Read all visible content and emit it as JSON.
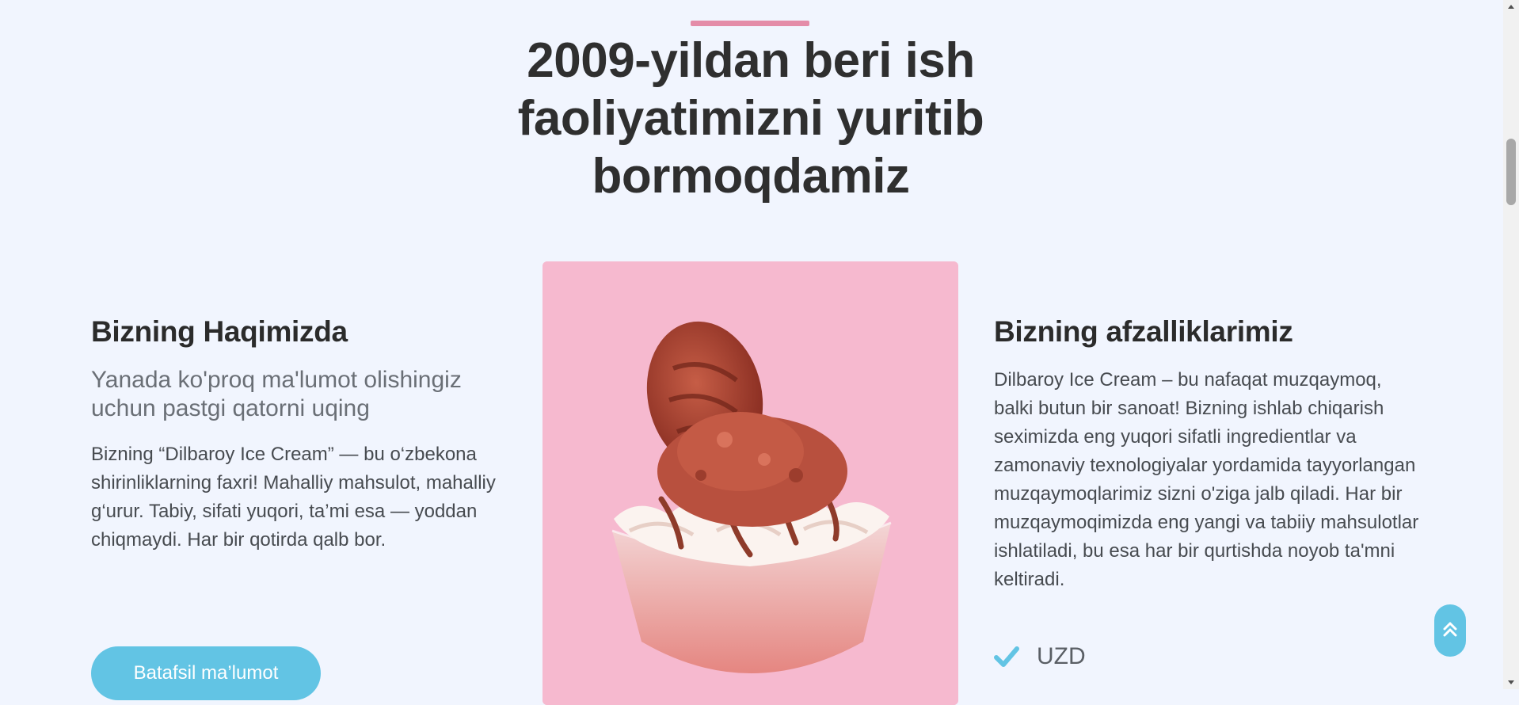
{
  "section": {
    "title": "2009-yildan beri ish faoliyatimizni yuritib bormoqdamiz"
  },
  "about": {
    "heading": "Bizning Haqimizda",
    "subheading": "Yanada ko'proq ma'lumot olishingiz uchun pastgi qatorni uqing",
    "text": "Bizning “Dilbaroy Ice Cream” — bu o‘zbekona shirinliklarning faxri! Mahalliy mahsulot, mahalliy g‘urur. Tabiy, sifati yuqori, ta’mi esa — yoddan chiqmaydi. Har bir qotirda qalb bor.",
    "button_label": "Batafsil ma’lumot"
  },
  "image": {
    "subject": "ice cream sundae with chocolate cookie on pink background"
  },
  "advantages": {
    "heading": "Bizning afzalliklarimiz",
    "text": "Dilbaroy Ice Cream – bu nafaqat muzqaymoq, balki butun bir sanoat! Bizning ishlab chiqarish seximizda eng yuqori sifatli ingredientlar va zamonaviy texnologiyalar yordamida tayyorlangan muzqaymoqlarimiz sizni o'ziga jalb qiladi. Har bir muzqaymoqimizda eng yangi va tabiiy mahsulotlar ishlatiladi, bu esa har bir qurtishda noyob ta'mni keltiradi.",
    "list": [
      {
        "label": "UZD",
        "icon": "check-icon"
      }
    ]
  },
  "scroll_top": {
    "icon": "double-chevron-up-icon"
  },
  "colors": {
    "background": "#f1f5fe",
    "accent": "#62c4e4",
    "title_bar": "#e48ca8",
    "photo_bg": "#f6b9cf"
  }
}
